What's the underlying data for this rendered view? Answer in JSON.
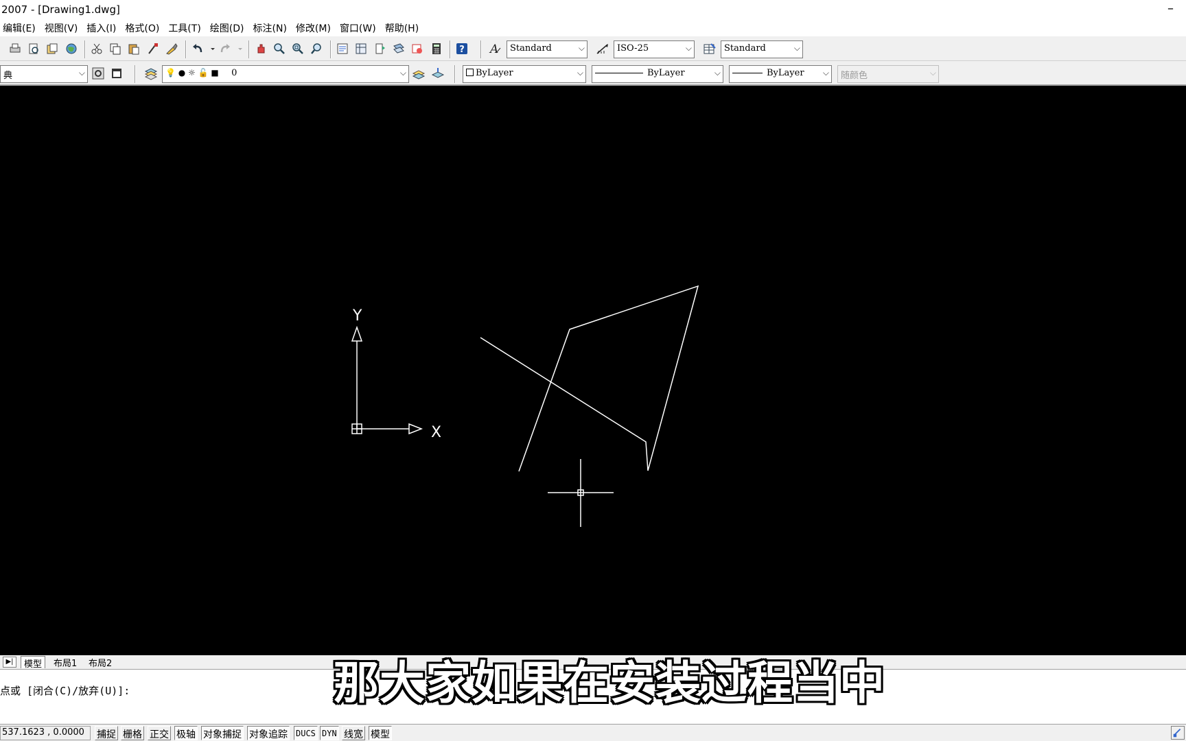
{
  "window": {
    "title": "2007 - [Drawing1.dwg]",
    "minimize_glyph": "–"
  },
  "menu": [
    "编辑(E)",
    "视图(V)",
    "插入(I)",
    "格式(O)",
    "工具(T)",
    "绘图(D)",
    "标注(N)",
    "修改(M)",
    "窗口(W)",
    "帮助(H)"
  ],
  "toolbar1": {
    "icons": [
      "plot-icon",
      "plot-preview-icon",
      "publish-icon",
      "web-icon",
      "cut-icon",
      "copy-icon",
      "paste-icon",
      "match-properties-icon",
      "block-editor-icon",
      "undo-icon",
      "redo-icon",
      "pan-icon",
      "zoom-realtime-icon",
      "zoom-window-icon",
      "zoom-previous-icon",
      "properties-icon",
      "design-center-icon",
      "tool-palettes-icon",
      "sheet-set-icon",
      "markup-icon",
      "calculator-icon",
      "help-icon"
    ],
    "text_style": "Standard",
    "dim_style": "ISO-25",
    "table_style": "Standard"
  },
  "toolbar2": {
    "workspace": "典",
    "layer": "0",
    "color": "ByLayer",
    "linetype": "ByLayer",
    "lineweight": "ByLayer",
    "plot_style": "随颜色"
  },
  "ucs": {
    "x_label": "X",
    "y_label": "Y"
  },
  "tabs": {
    "model": "模型",
    "layout1": "布局1",
    "layout2": "布局2",
    "nav_glyph": "▶|"
  },
  "subtitle": "那大家如果在安装过程当中",
  "command": {
    "prompt": "点或 [闭合(C)/放弃(U)]:"
  },
  "status": {
    "coords": "537.1623 , 0.0000",
    "buttons": [
      "捕捉",
      "栅格",
      "正交",
      "极轴",
      "对象捕捉",
      "对象追踪",
      "DUCS",
      "DYN",
      "线宽",
      "模型"
    ]
  },
  "colors": {
    "canvas": "#000000",
    "lines": "#ffffff",
    "ui": "#f0f0f0"
  }
}
